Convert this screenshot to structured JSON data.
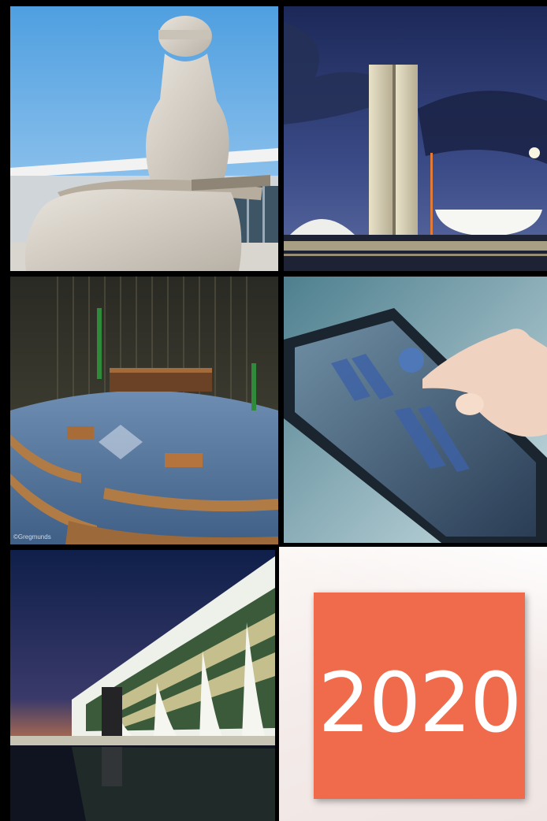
{
  "cover": {
    "year": "2020",
    "accent_color": "#ef6b4b"
  },
  "photos": [
    {
      "subject": "statue-of-justice-photo"
    },
    {
      "subject": "national-congress-night-photo"
    },
    {
      "subject": "chamber-of-deputies-plenary-photo"
    },
    {
      "subject": "tablet-touch-photo"
    },
    {
      "subject": "planalto-palace-dusk-photo"
    }
  ],
  "credit_text": "©Gregmunds"
}
